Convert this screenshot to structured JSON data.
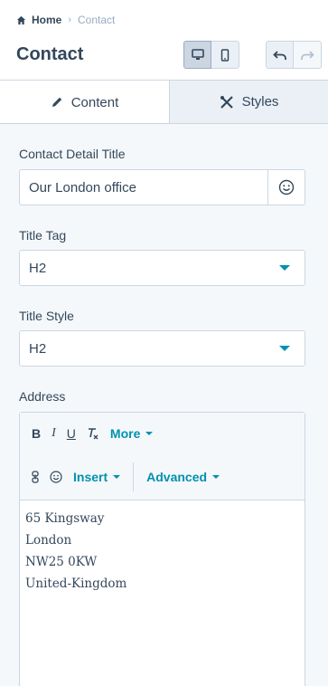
{
  "breadcrumb": {
    "home": "Home",
    "current": "Contact"
  },
  "page_title": "Contact",
  "tabs": {
    "content": "Content",
    "styles": "Styles"
  },
  "form": {
    "contact_title_label": "Contact Detail Title",
    "contact_title_value": "Our London office",
    "title_tag_label": "Title Tag",
    "title_tag_value": "H2",
    "title_style_label": "Title Style",
    "title_style_value": "H2",
    "address_label": "Address"
  },
  "editor": {
    "more": "More",
    "insert": "Insert",
    "advanced": "Advanced",
    "lines": [
      "65 Kingsway",
      "London",
      "NW25 0KW",
      "United-Kingdom"
    ]
  },
  "colors": {
    "accent": "#0091ae",
    "text": "#33475b",
    "border": "#cbd6e2",
    "panel": "#f5f8fa"
  }
}
